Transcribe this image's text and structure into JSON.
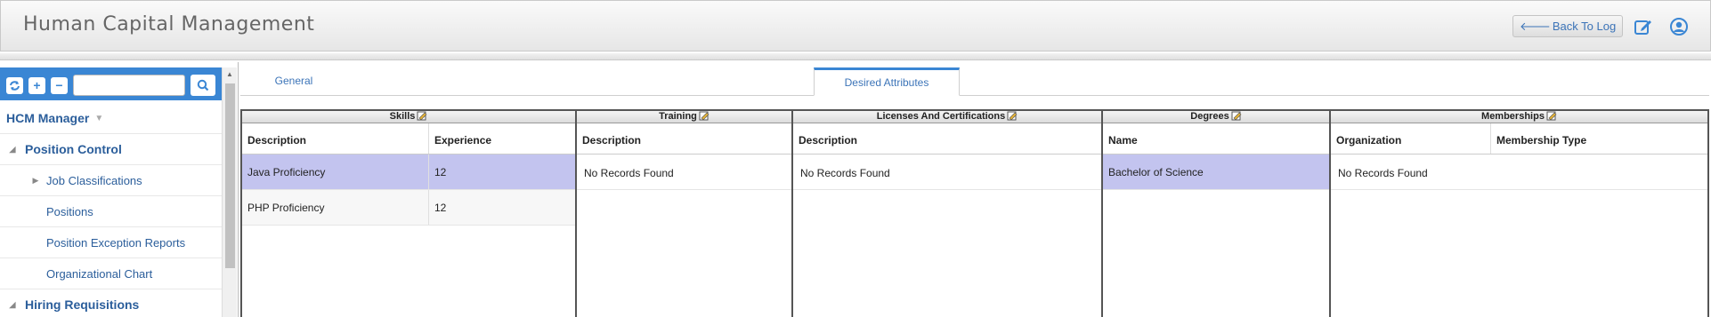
{
  "app": {
    "title": "Human Capital Management",
    "back_label": "Back To Log"
  },
  "sidebar": {
    "manager_label": "HCM Manager",
    "items": [
      {
        "label": "Position Control"
      },
      {
        "label": "Job Classifications"
      },
      {
        "label": "Positions"
      },
      {
        "label": "Position Exception Reports"
      },
      {
        "label": "Organizational Chart"
      },
      {
        "label": "Hiring Requisitions"
      }
    ]
  },
  "tabs": [
    {
      "label": "General"
    },
    {
      "label": "Desired Attributes"
    }
  ],
  "panels": {
    "skills": {
      "title": "Skills",
      "headers": [
        "Description",
        "Experience"
      ],
      "rows": [
        {
          "description": "Java Proficiency",
          "experience": "12"
        },
        {
          "description": "PHP Proficiency",
          "experience": "12"
        }
      ]
    },
    "training": {
      "title": "Training",
      "headers": [
        "Description"
      ],
      "empty": "No Records Found"
    },
    "licenses": {
      "title": "Licenses And Certifications",
      "headers": [
        "Description"
      ],
      "empty": "No Records Found"
    },
    "degrees": {
      "title": "Degrees",
      "headers": [
        "Name"
      ],
      "rows": [
        {
          "name": "Bachelor of Science"
        }
      ]
    },
    "memberships": {
      "title": "Memberships",
      "headers": [
        "Organization",
        "Membership Type"
      ],
      "empty": "No Records Found"
    }
  },
  "colors": {
    "accent": "#3a86d4",
    "selected_row": "#c3c4ef",
    "link": "#2b5e9b"
  }
}
